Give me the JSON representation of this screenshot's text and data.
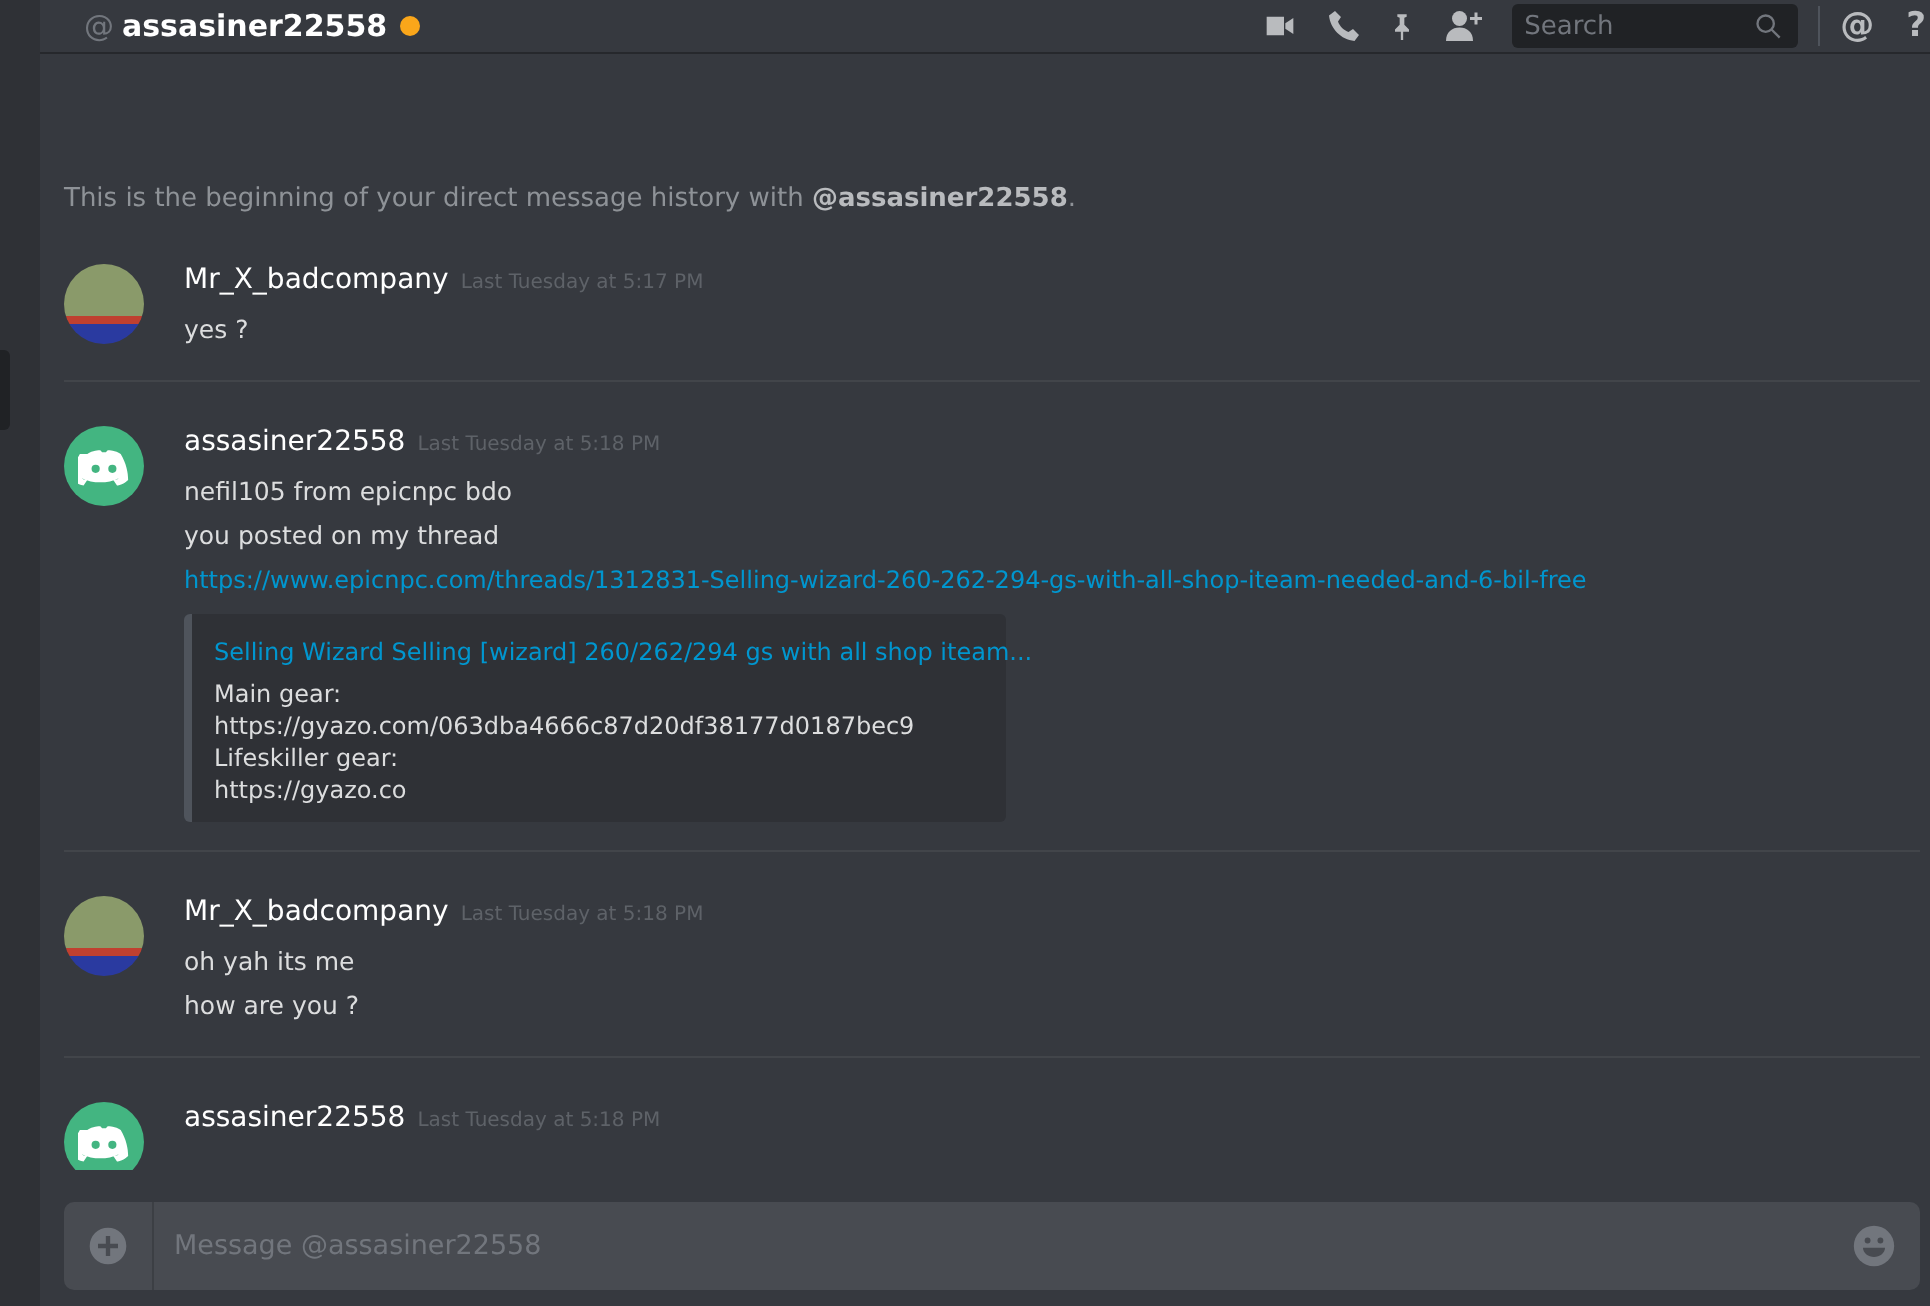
{
  "header": {
    "at_sign": "@",
    "username": "assasiner22558",
    "status": {
      "color": "#faa61a"
    },
    "search": {
      "placeholder": "Search"
    },
    "mention_symbol": "@",
    "help_symbol": "?"
  },
  "intro": "This is the beginning of your direct message history with **@assasiner22558**.",
  "messages": [
    {
      "avatar": {
        "kind": "photo"
      },
      "author": "Mr_X_badcompany",
      "timestamp": "Last Tuesday at 5:17 PM",
      "lines": [
        {
          "kind": "text",
          "text": "yes ?"
        }
      ]
    },
    {
      "avatar": {
        "kind": "logo"
      },
      "author": "assasiner22558",
      "timestamp": "Last Tuesday at 5:18 PM",
      "lines": [
        {
          "kind": "text",
          "text": "nefil105 from epicnpc bdo"
        },
        {
          "kind": "text",
          "text": "you posted on my thread"
        },
        {
          "kind": "link",
          "text": "https://www.epicnpc.com/threads/1312831-Selling-wizard-260-262-294-gs-with-all-shop-iteam-needed-and-6-bil-free"
        },
        {
          "kind": "embed",
          "title": "Selling Wizard Selling [wizard] 260/262/294 gs with all shop iteam...",
          "description": [
            "Main gear:",
            "https://gyazo.com/063dba4666c87d20df38177d0187bec9",
            "Lifeskiller gear:",
            "https://gyazo.co"
          ]
        }
      ]
    },
    {
      "avatar": {
        "kind": "photo"
      },
      "author": "Mr_X_badcompany",
      "timestamp": "Last Tuesday at 5:18 PM",
      "lines": [
        {
          "kind": "text",
          "text": "oh yah its me"
        },
        {
          "kind": "text",
          "text": "how are you ?"
        }
      ]
    },
    {
      "avatar": {
        "kind": "logo"
      },
      "author": "assasiner22558",
      "timestamp": "Last Tuesday at 5:18 PM"
    }
  ],
  "composer": {
    "placeholder": "Message @assasiner22558"
  }
}
